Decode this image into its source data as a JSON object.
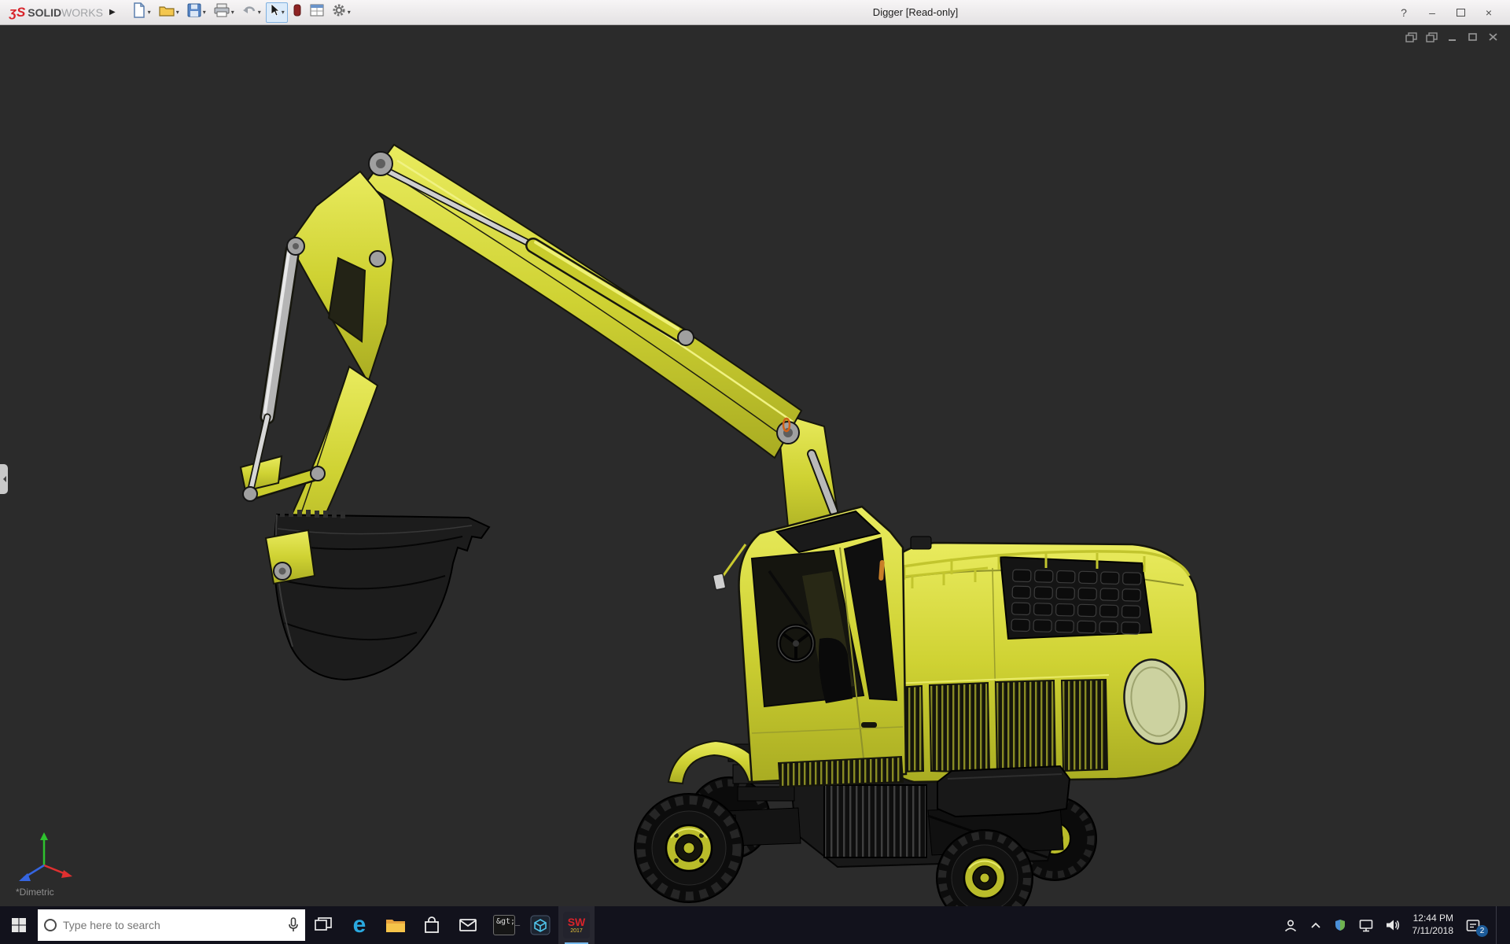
{
  "window": {
    "title": "Digger [Read-only]",
    "brand": {
      "glyph": "ʒS",
      "solid": "SOLID",
      "works": "WORKS"
    },
    "expand_glyph": "▶",
    "help_glyph": "?",
    "minimize_glyph": "–",
    "close_glyph": "×"
  },
  "glyphs": {
    "caret": "▾"
  },
  "toolbar": {
    "items": [
      "new-document",
      "open-document",
      "save",
      "print",
      "undo",
      "select-tool",
      "abort",
      "options-report",
      "settings"
    ]
  },
  "viewport": {
    "orientation": "*Dimetric",
    "model_name": "digger-excavator"
  },
  "taskbar": {
    "search_placeholder": "Type here to search",
    "icons": {
      "edge": "e",
      "console": "&gt;_",
      "solidworks_label": "SW",
      "solidworks_year": "2017"
    },
    "tray": {
      "time": "12:44 PM",
      "date": "7/11/2018",
      "notification_count": "2"
    }
  },
  "colors": {
    "excavator_yellow": "#cfd233",
    "viewport_background": "#2b2b2b",
    "taskbar_background": "#12121c",
    "menubar_background": "#eceaeb",
    "accent_orange": "#c87f28"
  }
}
